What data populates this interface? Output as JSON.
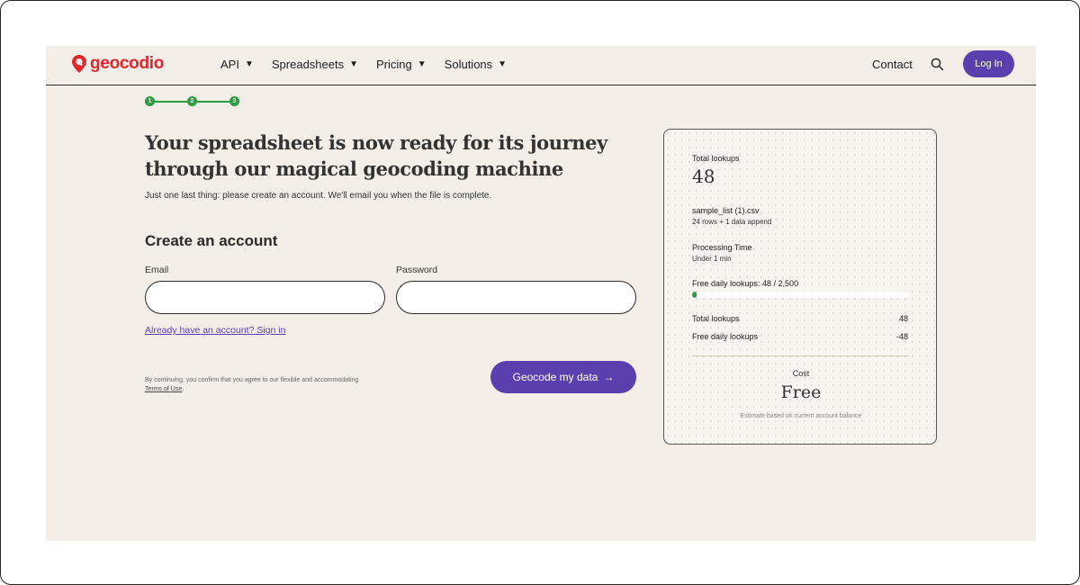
{
  "header": {
    "brand": "geocodio",
    "nav": [
      {
        "label": "API",
        "icon": "caret-down-icon"
      },
      {
        "label": "Spreadsheets",
        "icon": "caret-down-icon"
      },
      {
        "label": "Pricing",
        "icon": "caret-down-icon"
      },
      {
        "label": "Solutions",
        "icon": "caret-down-icon"
      }
    ],
    "contact": "Contact",
    "login": "Log In"
  },
  "steps": [
    "1",
    "2",
    "3"
  ],
  "main": {
    "headline": "Your spreadsheet is now ready for its journey through our magical geocoding machine",
    "subtext": "Just one last thing: please create an account. We'll email you when the file is complete.",
    "form_title": "Create an account",
    "email_label": "Email",
    "email_value": "",
    "password_label": "Password",
    "password_value": "",
    "signin_link": "Already have an account? Sign in",
    "terms_text": "By continuing, you confirm that you agree to our flexible and accommodating",
    "terms_link": "Terms of Use",
    "terms_period": ".",
    "submit_label": "Geocode my data",
    "submit_arrow": "→"
  },
  "summary": {
    "total_lookups_label": "Total lookups",
    "total_lookups_value": "48",
    "file_name": "sample_list (1).csv",
    "file_detail": "24 rows + 1 data append",
    "processing_label": "Processing Time",
    "processing_value": "Under 1 min",
    "free_daily_label": "Free daily lookups: 48 / 2,500",
    "free_daily_used": 48,
    "free_daily_total": 2500,
    "rows": [
      {
        "label": "Total lookups",
        "value": "48"
      },
      {
        "label": "Free daily lookups",
        "value": "-48"
      }
    ],
    "cost_label": "Cost",
    "cost_value": "Free",
    "cost_note": "Estimate based on current account balance"
  },
  "colors": {
    "brand_red": "#e4262f",
    "accent_purple": "#5a3fae",
    "progress_green": "#2a9d3f",
    "page_bg": "#f3efe8"
  }
}
